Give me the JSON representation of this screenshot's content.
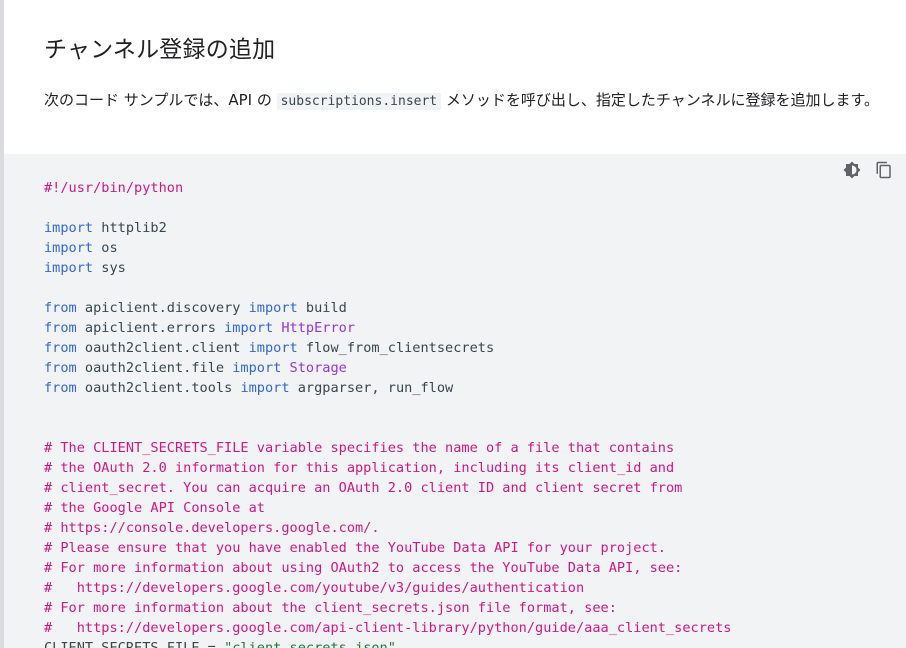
{
  "section": {
    "title": "チャンネル登録の追加",
    "description_before": "次のコード サンプルでは、API の ",
    "description_code": "subscriptions.insert",
    "description_after": " メソッドを呼び出し、指定したチャンネルに登録を追加します。"
  },
  "toolbar": {
    "theme_toggle_icon": "brightness-icon",
    "copy_icon": "copy-icon"
  },
  "colors": {
    "keyword": "#3367d6",
    "comment": "#d01884",
    "class": "#9334e6",
    "string": "#188038",
    "text": "#37474f",
    "code_bg": "#f1f3f4"
  },
  "code_lines": [
    [
      {
        "t": "#!/usr/bin/python",
        "c": "cm"
      }
    ],
    [],
    [
      {
        "t": "import",
        "c": "kw"
      },
      {
        "t": " httplib2"
      }
    ],
    [
      {
        "t": "import",
        "c": "kw"
      },
      {
        "t": " os"
      }
    ],
    [
      {
        "t": "import",
        "c": "kw"
      },
      {
        "t": " sys"
      }
    ],
    [],
    [
      {
        "t": "from",
        "c": "kw"
      },
      {
        "t": " apiclient.discovery "
      },
      {
        "t": "import",
        "c": "kw"
      },
      {
        "t": " build"
      }
    ],
    [
      {
        "t": "from",
        "c": "kw"
      },
      {
        "t": " apiclient.errors "
      },
      {
        "t": "import",
        "c": "kw"
      },
      {
        "t": " "
      },
      {
        "t": "HttpError",
        "c": "cls"
      }
    ],
    [
      {
        "t": "from",
        "c": "kw"
      },
      {
        "t": " oauth2client.client "
      },
      {
        "t": "import",
        "c": "kw"
      },
      {
        "t": " flow_from_clientsecrets"
      }
    ],
    [
      {
        "t": "from",
        "c": "kw"
      },
      {
        "t": " oauth2client.file "
      },
      {
        "t": "import",
        "c": "kw"
      },
      {
        "t": " "
      },
      {
        "t": "Storage",
        "c": "cls"
      }
    ],
    [
      {
        "t": "from",
        "c": "kw"
      },
      {
        "t": " oauth2client.tools "
      },
      {
        "t": "import",
        "c": "kw"
      },
      {
        "t": " argparser, run_flow"
      }
    ],
    [],
    [],
    [
      {
        "t": "# The CLIENT_SECRETS_FILE variable specifies the name of a file that contains",
        "c": "cm"
      }
    ],
    [
      {
        "t": "# the OAuth 2.0 information for this application, including its client_id and",
        "c": "cm"
      }
    ],
    [
      {
        "t": "# client_secret. You can acquire an OAuth 2.0 client ID and client secret from",
        "c": "cm"
      }
    ],
    [
      {
        "t": "# the Google API Console at",
        "c": "cm"
      }
    ],
    [
      {
        "t": "# https://console.developers.google.com/.",
        "c": "cm"
      }
    ],
    [
      {
        "t": "# Please ensure that you have enabled the YouTube Data API for your project.",
        "c": "cm"
      }
    ],
    [
      {
        "t": "# For more information about using OAuth2 to access the YouTube Data API, see:",
        "c": "cm"
      }
    ],
    [
      {
        "t": "#   https://developers.google.com/youtube/v3/guides/authentication",
        "c": "cm"
      }
    ],
    [
      {
        "t": "# For more information about the client_secrets.json file format, see:",
        "c": "cm"
      }
    ],
    [
      {
        "t": "#   https://developers.google.com/api-client-library/python/guide/aaa_client_secrets",
        "c": "cm"
      }
    ],
    [
      {
        "t": "CLIENT_SECRETS_FILE = "
      },
      {
        "t": "\"client_secrets.json\"",
        "c": "str"
      }
    ]
  ]
}
